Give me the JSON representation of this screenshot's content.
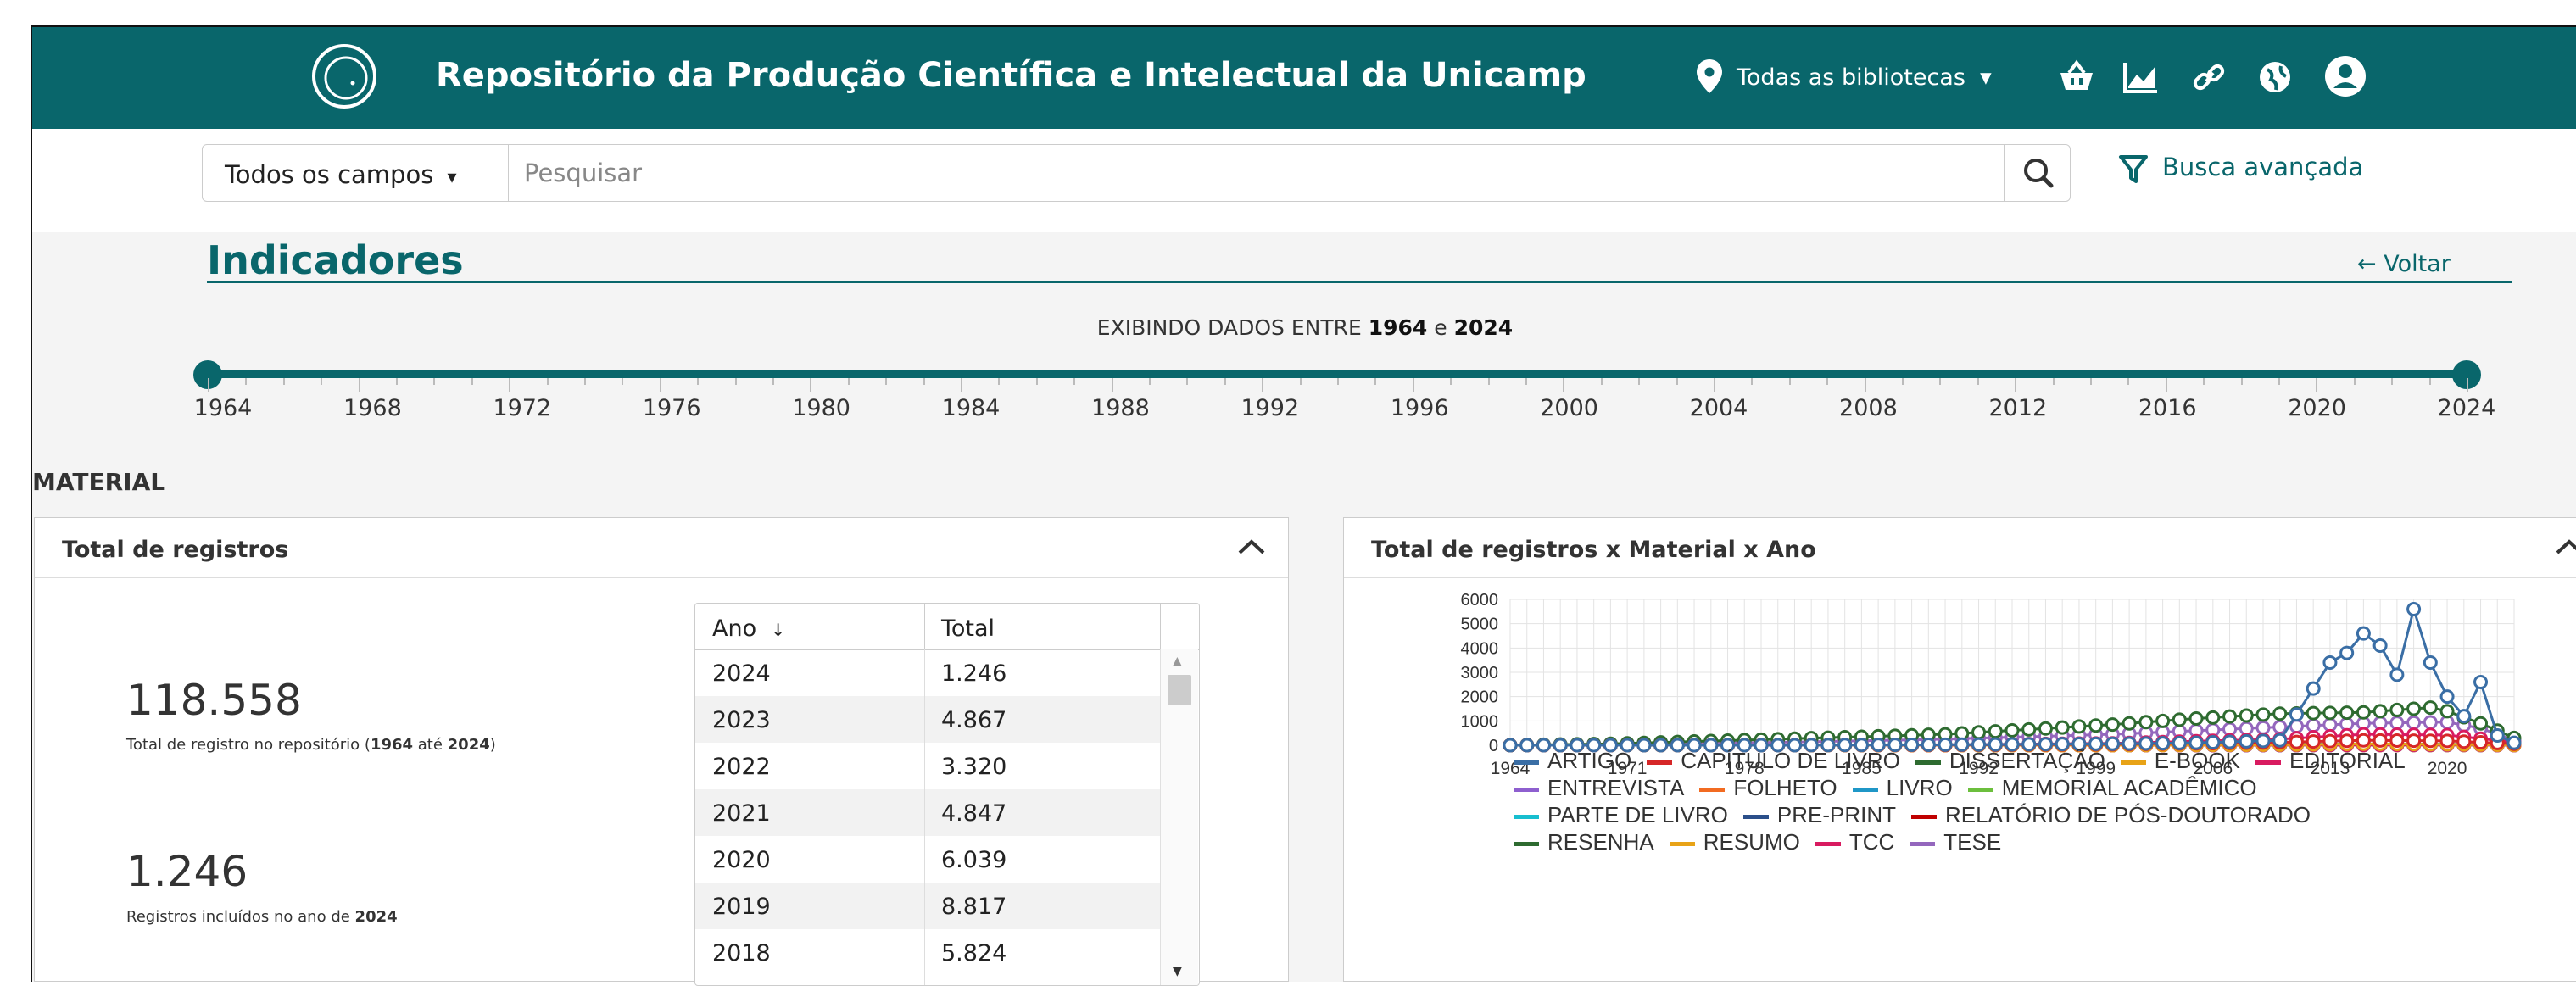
{
  "header": {
    "site_title": "Repositório da Produção Científica e Intelectual da Unicamp",
    "library_select": "Todas as bibliotecas",
    "icons": [
      "location-pin-icon",
      "basket-icon",
      "chart-icon",
      "link-icon",
      "globe-icon",
      "user-icon"
    ]
  },
  "search": {
    "field_select": "Todos os campos",
    "placeholder": "Pesquisar",
    "advanced_label": "Busca avançada"
  },
  "indicators": {
    "title": "Indicadores",
    "back_label": "Voltar",
    "range_prefix": "EXIBINDO DADOS ENTRE",
    "range_start": "1964",
    "range_sep": "e",
    "range_end": "2024",
    "ticks": [
      "1964",
      "1968",
      "1972",
      "1976",
      "1980",
      "1984",
      "1988",
      "1992",
      "1996",
      "2000",
      "2004",
      "2008",
      "2012",
      "2016",
      "2020",
      "2024"
    ]
  },
  "section_label": "MATERIAL",
  "panel_total": {
    "title": "Total de registros",
    "total_value": "118.558",
    "total_caption_pre": "Total de registro no repositório (",
    "total_caption_from": "1964",
    "total_caption_mid": " até ",
    "total_caption_to": "2024",
    "total_caption_post": ")",
    "year_value": "1.246",
    "year_caption_pre": "Registros incluídos no ano de ",
    "year_caption_year": "2024",
    "table": {
      "headers": [
        "Ano",
        "Total"
      ],
      "sort_arrow": "↓",
      "rows": [
        {
          "ano": "2024",
          "total": "1.246"
        },
        {
          "ano": "2023",
          "total": "4.867"
        },
        {
          "ano": "2022",
          "total": "3.320"
        },
        {
          "ano": "2021",
          "total": "4.847"
        },
        {
          "ano": "2020",
          "total": "6.039"
        },
        {
          "ano": "2019",
          "total": "8.817"
        },
        {
          "ano": "2018",
          "total": "5.824"
        }
      ]
    }
  },
  "panel_chart": {
    "title": "Total de registros x Material x Ano"
  },
  "chart_data": {
    "type": "line",
    "title": "",
    "xlabel": "",
    "ylabel": "",
    "ylim": [
      0,
      6000
    ],
    "yticks": [
      "6000",
      "5000",
      "4000",
      "3000",
      "2000",
      "1000",
      "0"
    ],
    "xticks": [
      "1964",
      "1971",
      "1978",
      "1985",
      "1992",
      "1999",
      "2006",
      "2013",
      "2020"
    ],
    "x_start": 1964,
    "x_end": 2024,
    "grid": true,
    "legend_position": "bottom",
    "series": [
      {
        "name": "ARTIGO",
        "color": "#3a6ea5",
        "x": [
          1964,
          1980,
          1990,
          2000,
          2005,
          2010,
          2013,
          2014,
          2015,
          2016,
          2017,
          2018,
          2019,
          2020,
          2021,
          2022,
          2023,
          2024
        ],
        "values": [
          0,
          0,
          20,
          60,
          100,
          200,
          3400,
          3800,
          4600,
          4100,
          2900,
          5600,
          3400,
          2000,
          1200,
          2600,
          400,
          100
        ]
      },
      {
        "name": "CAPÍTULO DE LIVRO",
        "color": "#d62728",
        "x": [
          1964,
          1990,
          2000,
          2010,
          2015,
          2020,
          2024
        ],
        "values": [
          0,
          10,
          40,
          120,
          200,
          180,
          60
        ]
      },
      {
        "name": "DISSERTAÇÃO",
        "color": "#2e6b30",
        "x": [
          1964,
          1970,
          1980,
          1990,
          1995,
          2000,
          2005,
          2010,
          2015,
          2019,
          2020,
          2022,
          2024
        ],
        "values": [
          0,
          60,
          250,
          450,
          650,
          850,
          1100,
          1300,
          1350,
          1550,
          1400,
          900,
          300
        ]
      },
      {
        "name": "E-BOOK",
        "color": "#e8a317",
        "x": [
          1964,
          2000,
          2010,
          2015,
          2020,
          2024
        ],
        "values": [
          0,
          0,
          20,
          60,
          40,
          10
        ]
      },
      {
        "name": "EDITORIAL",
        "color": "#d81b60",
        "x": [
          1964,
          2000,
          2010,
          2020,
          2024
        ],
        "values": [
          0,
          0,
          10,
          20,
          5
        ]
      },
      {
        "name": "ENTREVISTA",
        "color": "#8e5fcf",
        "x": [
          1964,
          2000,
          2010,
          2020,
          2024
        ],
        "values": [
          0,
          0,
          5,
          10,
          2
        ]
      },
      {
        "name": "FOLHETO",
        "color": "#f26b21",
        "x": [
          1964,
          2000,
          2010,
          2020,
          2024
        ],
        "values": [
          0,
          0,
          5,
          5,
          0
        ]
      },
      {
        "name": "LIVRO",
        "color": "#1f97c7",
        "x": [
          1964,
          1990,
          2000,
          2010,
          2020,
          2024
        ],
        "values": [
          0,
          10,
          30,
          60,
          50,
          20
        ]
      },
      {
        "name": "MEMORIAL ACADÊMICO",
        "color": "#6cbf3d",
        "x": [
          1964,
          1990,
          2000,
          2010,
          2020,
          2024
        ],
        "values": [
          0,
          5,
          10,
          15,
          10,
          5
        ]
      },
      {
        "name": "PARTE DE LIVRO",
        "color": "#17becf",
        "x": [
          1964,
          2000,
          2010,
          2020,
          2024
        ],
        "values": [
          0,
          10,
          30,
          40,
          10
        ]
      },
      {
        "name": "PRE-PRINT",
        "color": "#2b4f8a",
        "x": [
          1964,
          2010,
          2020,
          2024
        ],
        "values": [
          0,
          0,
          20,
          5
        ]
      },
      {
        "name": "RELATÓRIO DE PÓS-DOUTORADO",
        "color": "#c00000",
        "x": [
          1964,
          2000,
          2010,
          2020,
          2024
        ],
        "values": [
          0,
          0,
          10,
          20,
          5
        ]
      },
      {
        "name": "RESENHA",
        "color": "#2e6b30",
        "x": [
          1964,
          2000,
          2010,
          2020,
          2024
        ],
        "values": [
          0,
          5,
          15,
          20,
          5
        ]
      },
      {
        "name": "RESUMO",
        "color": "#e8a317",
        "x": [
          1964,
          2000,
          2010,
          2020,
          2024
        ],
        "values": [
          0,
          0,
          10,
          10,
          0
        ]
      },
      {
        "name": "TCC",
        "color": "#d81b60",
        "x": [
          1964,
          1990,
          2000,
          2010,
          2015,
          2020,
          2024
        ],
        "values": [
          0,
          20,
          80,
          250,
          450,
          420,
          120
        ]
      },
      {
        "name": "TESE",
        "color": "#9467bd",
        "x": [
          1964,
          1970,
          1980,
          1990,
          1995,
          2000,
          2005,
          2010,
          2015,
          2020,
          2022,
          2024
        ],
        "values": [
          0,
          40,
          120,
          250,
          350,
          450,
          600,
          750,
          900,
          950,
          700,
          200
        ]
      }
    ]
  }
}
